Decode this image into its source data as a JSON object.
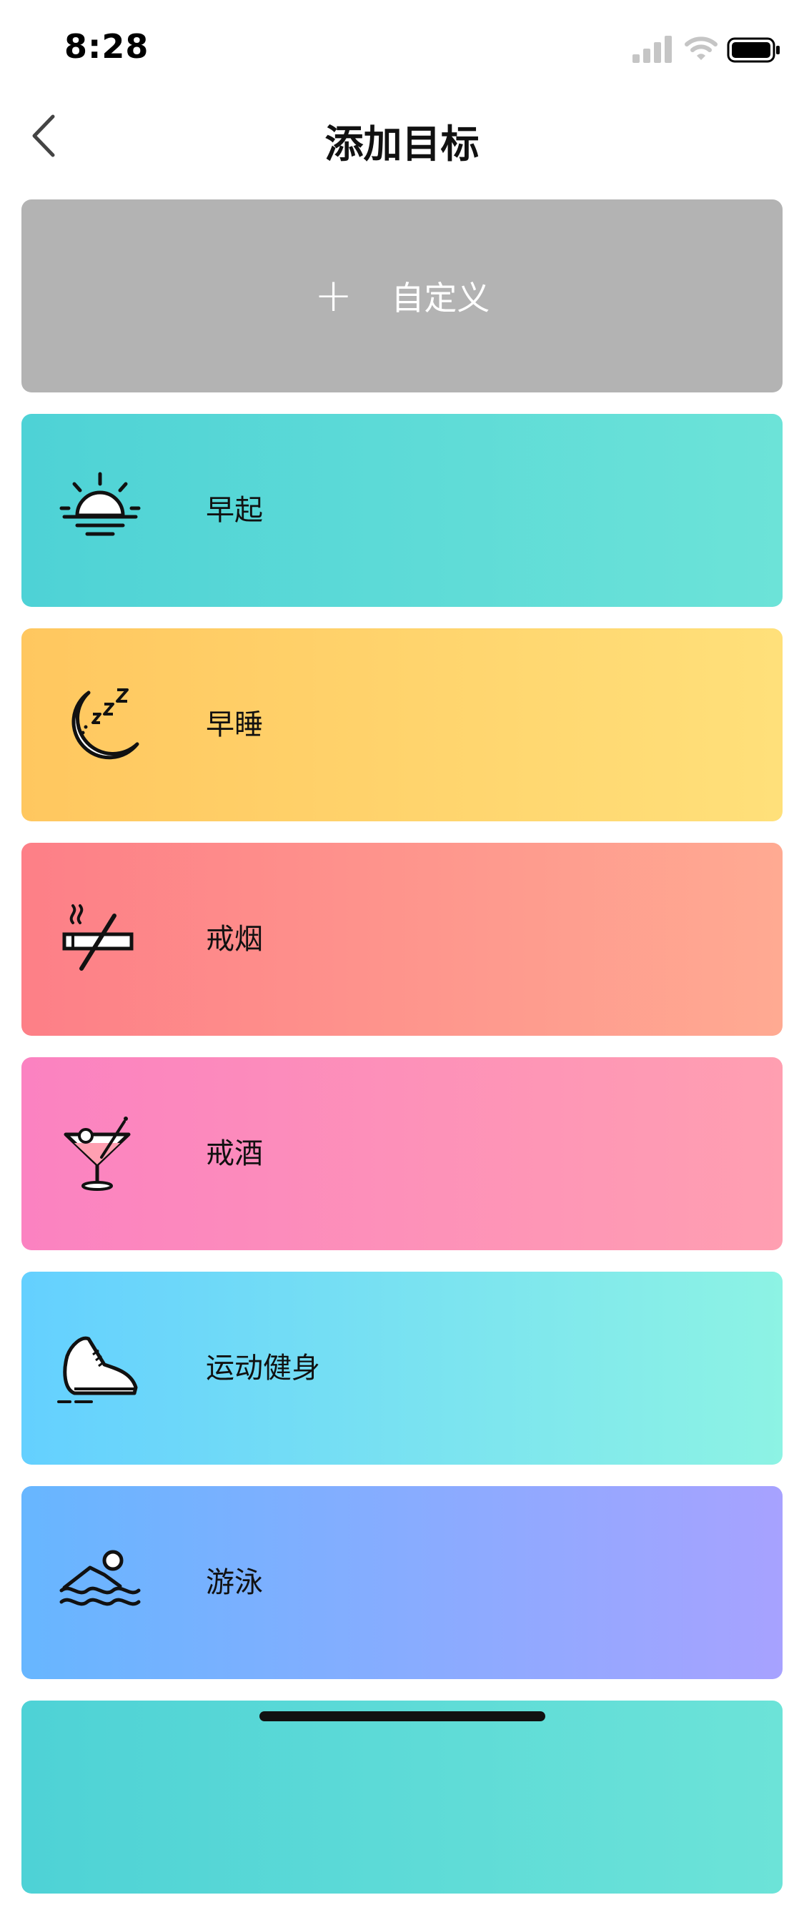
{
  "status_bar": {
    "time": "8:28"
  },
  "nav": {
    "title": "添加目标"
  },
  "custom": {
    "plus": "+",
    "label": "自定义"
  },
  "goals": [
    {
      "label": "早起",
      "icon": "sunrise-icon",
      "colors": [
        "#4ed2d6",
        "#6ce3d8"
      ]
    },
    {
      "label": "早睡",
      "icon": "moon-sleep-icon",
      "colors": [
        "#ffc75f",
        "#ffe07a"
      ]
    },
    {
      "label": "戒烟",
      "icon": "no-smoking-icon",
      "colors": [
        "#fd7f87",
        "#ffaa92"
      ]
    },
    {
      "label": "戒酒",
      "icon": "cocktail-icon",
      "colors": [
        "#fb82c1",
        "#ff9fb1"
      ]
    },
    {
      "label": "运动健身",
      "icon": "sneaker-icon",
      "colors": [
        "#64d0ff",
        "#8df3e4"
      ]
    },
    {
      "label": "游泳",
      "icon": "swimmer-icon",
      "colors": [
        "#67b6ff",
        "#a7a2ff"
      ]
    },
    {
      "label": "",
      "icon": "",
      "colors": [
        "#4ed2d6",
        "#6ce3d8"
      ]
    }
  ]
}
